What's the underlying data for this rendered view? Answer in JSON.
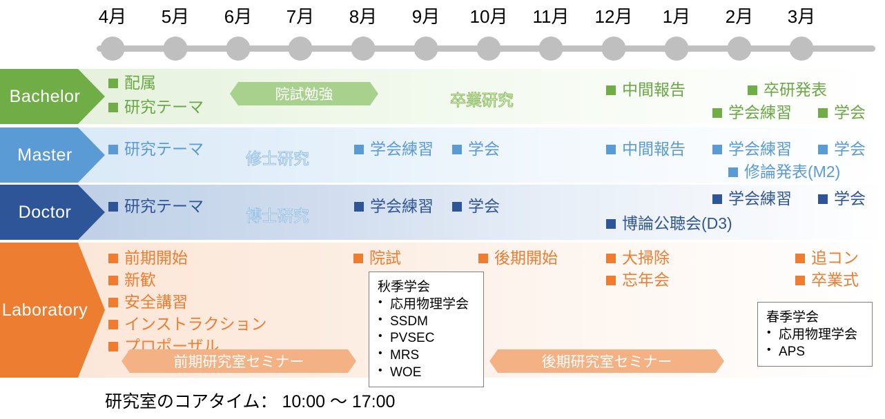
{
  "timeline": {
    "months": [
      "4月",
      "5月",
      "6月",
      "7月",
      "8月",
      "9月",
      "10月",
      "11月",
      "12月",
      "1月",
      "2月",
      "3月"
    ]
  },
  "colors": {
    "bachelor": "#70ad47",
    "bachelor_text": "#6aa844",
    "bachelor_band": "#a9d18e",
    "master": "#5b9bd5",
    "master_text": "#5b9bd5",
    "doctor": "#2e5597",
    "doctor_text": "#2f5597",
    "laboratory": "#ed7d31",
    "laboratory_text": "#ed7d31",
    "laboratory_band": "#f4b183",
    "timeline_gray": "#bfbfbf"
  },
  "rows": [
    {
      "key": "bachelor",
      "label": "Bachelor",
      "items": [
        {
          "text": "配属"
        },
        {
          "text": "研究テーマ"
        },
        {
          "text": "中間報告"
        },
        {
          "text": "卒研発表"
        },
        {
          "text": "学会練習"
        },
        {
          "text": "学会"
        }
      ],
      "banners": [
        {
          "text": "院試勉強"
        }
      ],
      "outlines": [
        {
          "text": "卒業研究"
        }
      ]
    },
    {
      "key": "master",
      "label": "Master",
      "items": [
        {
          "text": "研究テーマ"
        },
        {
          "text": "学会練習"
        },
        {
          "text": "学会"
        },
        {
          "text": "中間報告"
        },
        {
          "text": "学会練習"
        },
        {
          "text": "学会"
        },
        {
          "text": "修論発表(M2)"
        }
      ],
      "banners": [],
      "outlines": [
        {
          "text": "修士研究"
        }
      ]
    },
    {
      "key": "doctor",
      "label": "Doctor",
      "items": [
        {
          "text": "研究テーマ"
        },
        {
          "text": "学会練習"
        },
        {
          "text": "学会"
        },
        {
          "text": "学会練習"
        },
        {
          "text": "学会"
        },
        {
          "text": "博論公聴会(D3)"
        }
      ],
      "banners": [],
      "outlines": [
        {
          "text": "博士研究"
        }
      ]
    },
    {
      "key": "laboratory",
      "label": "Laboratory",
      "items": [
        {
          "text": "前期開始"
        },
        {
          "text": "新歓"
        },
        {
          "text": "安全講習"
        },
        {
          "text": "インストラクション"
        },
        {
          "text": "プロポーザル"
        },
        {
          "text": "院試"
        },
        {
          "text": "後期開始"
        },
        {
          "text": "大掃除"
        },
        {
          "text": "忘年会"
        },
        {
          "text": "追コン"
        },
        {
          "text": "卒業式"
        }
      ],
      "banners": [
        {
          "text": "前期研究室セミナー"
        },
        {
          "text": "後期研究室セミナー"
        }
      ],
      "outlines": []
    }
  ],
  "noteboxes": [
    {
      "key": "autumn-conferences",
      "title": "秋季学会",
      "entries": [
        "応用物理学会",
        "SSDM",
        "PVSEC",
        "MRS",
        "WOE"
      ]
    },
    {
      "key": "spring-conferences",
      "title": "春季学会",
      "entries": [
        "応用物理学会",
        "APS"
      ]
    }
  ],
  "footer": {
    "text": "研究室のコアタイム： 10:00 ～ 17:00"
  }
}
